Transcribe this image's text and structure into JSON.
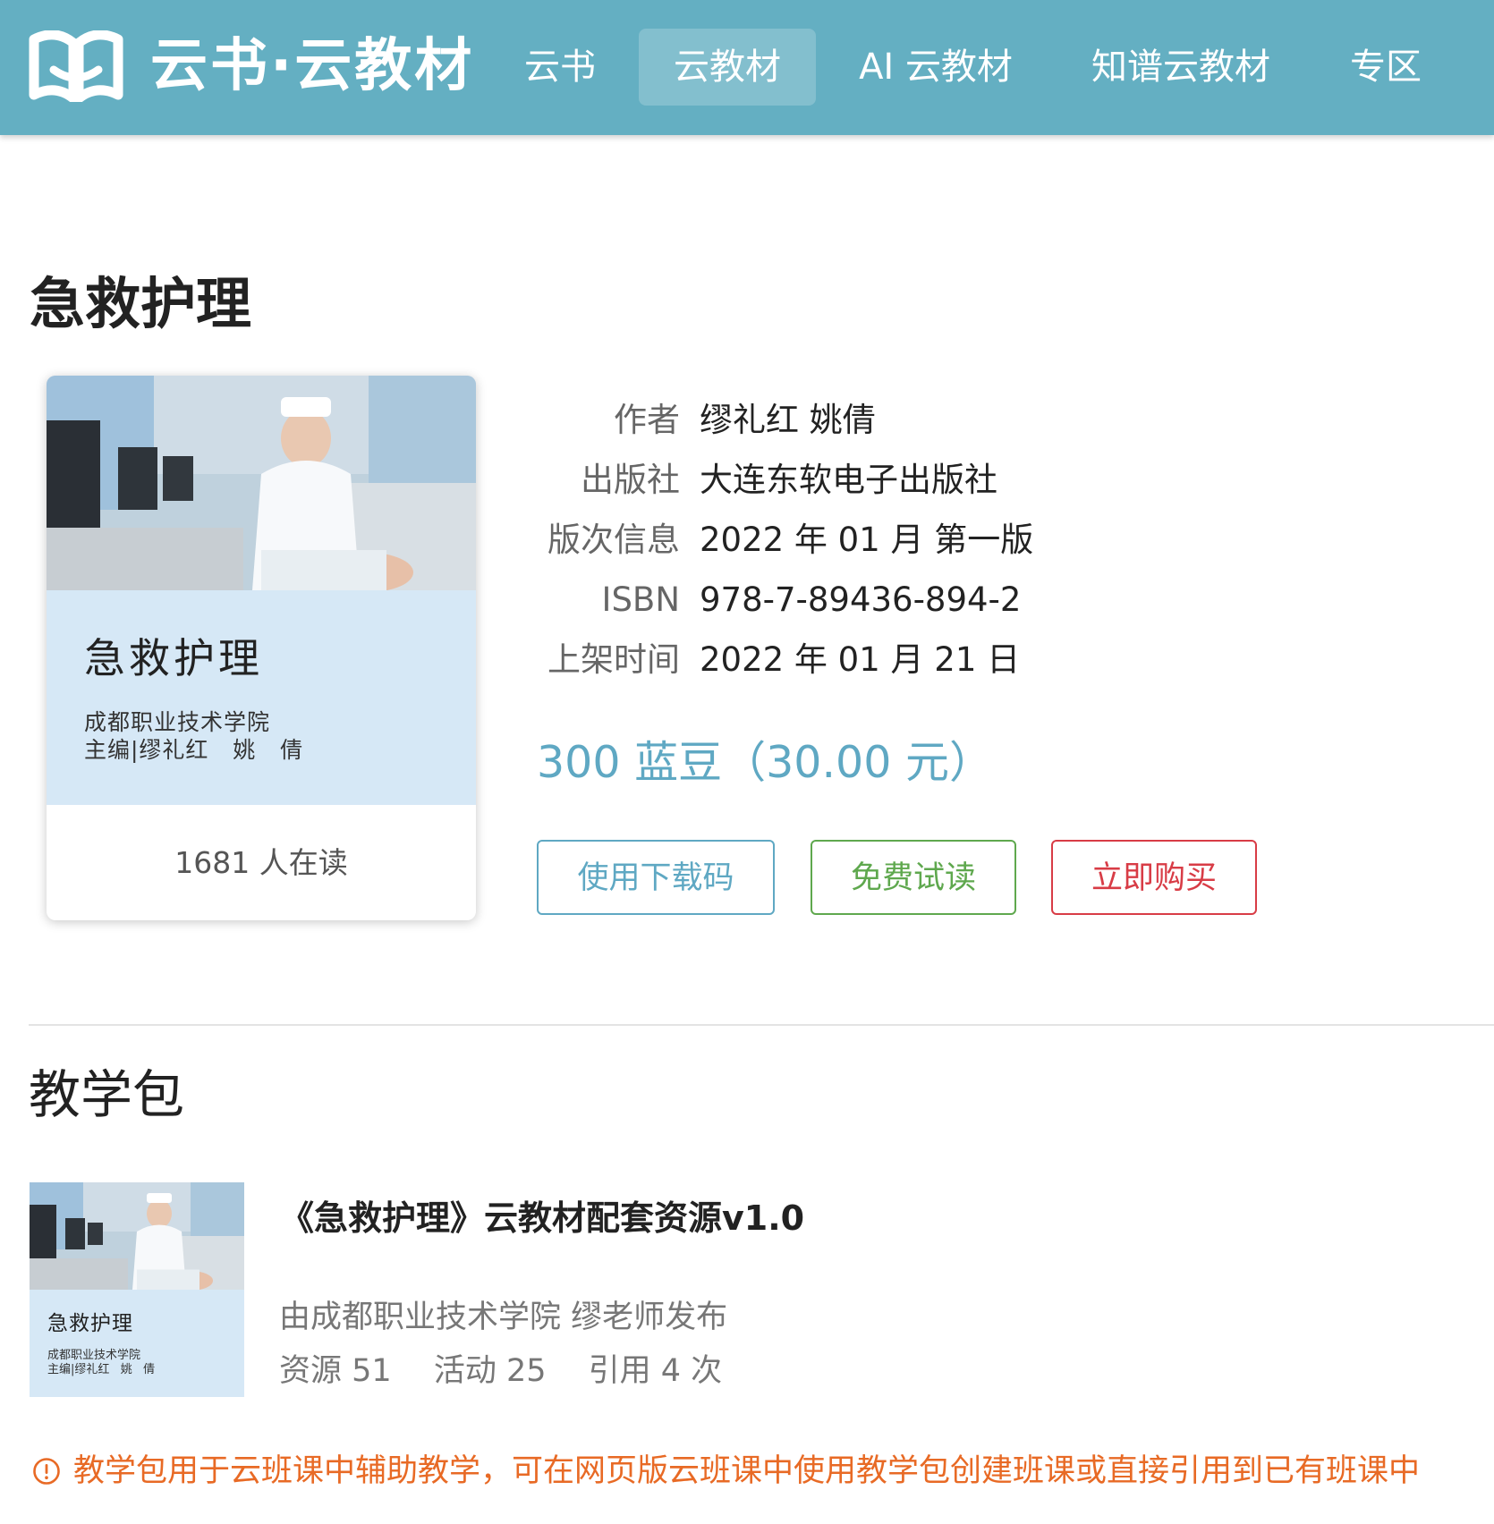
{
  "header": {
    "logo_text": "云书·云教材",
    "nav": [
      {
        "label": "云书",
        "active": false
      },
      {
        "label": "云教材",
        "active": true
      },
      {
        "label": "AI 云教材",
        "active": false
      },
      {
        "label": "知谱云教材",
        "active": false
      },
      {
        "label": "专区",
        "active": false
      }
    ]
  },
  "book": {
    "title": "急救护理",
    "cover": {
      "title": "急救护理",
      "subtitle": "成都职业技术学院\n主编|缪礼红   姚   倩"
    },
    "readers": "1681 人在读",
    "info": [
      {
        "label": "作者",
        "value": "缪礼红 姚倩"
      },
      {
        "label": "出版社",
        "value": "大连东软电子出版社"
      },
      {
        "label": "版次信息",
        "value": "2022 年 01 月 第一版"
      },
      {
        "label": "ISBN",
        "value": "978-7-89436-894-2"
      },
      {
        "label": "上架时间",
        "value": "2022 年 01 月 21 日"
      }
    ],
    "price": "300 蓝豆（30.00 元）",
    "buttons": {
      "download": "使用下载码",
      "trial": "免费试读",
      "buy": "立即购买"
    }
  },
  "teaching_pack": {
    "section_title": "教学包",
    "cover": {
      "title": "急救护理",
      "subtitle": "成都职业技术学院\n主编|缪礼红   姚   倩"
    },
    "title": "《急救护理》云教材配套资源v1.0",
    "publisher": "由成都职业技术学院 缪老师发布",
    "stats": {
      "resources": "资源 51",
      "activities": "活动 25",
      "citations": "引用 4 次"
    },
    "notice": "教学包用于云班课中辅助教学，可在网页版云班课中使用教学包创建班课或直接引用到已有班课中"
  },
  "colors": {
    "header_bg": "#64afc2",
    "price": "#5fa8c3",
    "download": "#5fa8c3",
    "trial": "#5fa84e",
    "buy": "#d83c46",
    "notice": "#e86a25",
    "cover_bg": "#d6e8f6"
  },
  "icons": {
    "logo": "open-book-icon",
    "notice": "exclamation-circle-icon"
  }
}
